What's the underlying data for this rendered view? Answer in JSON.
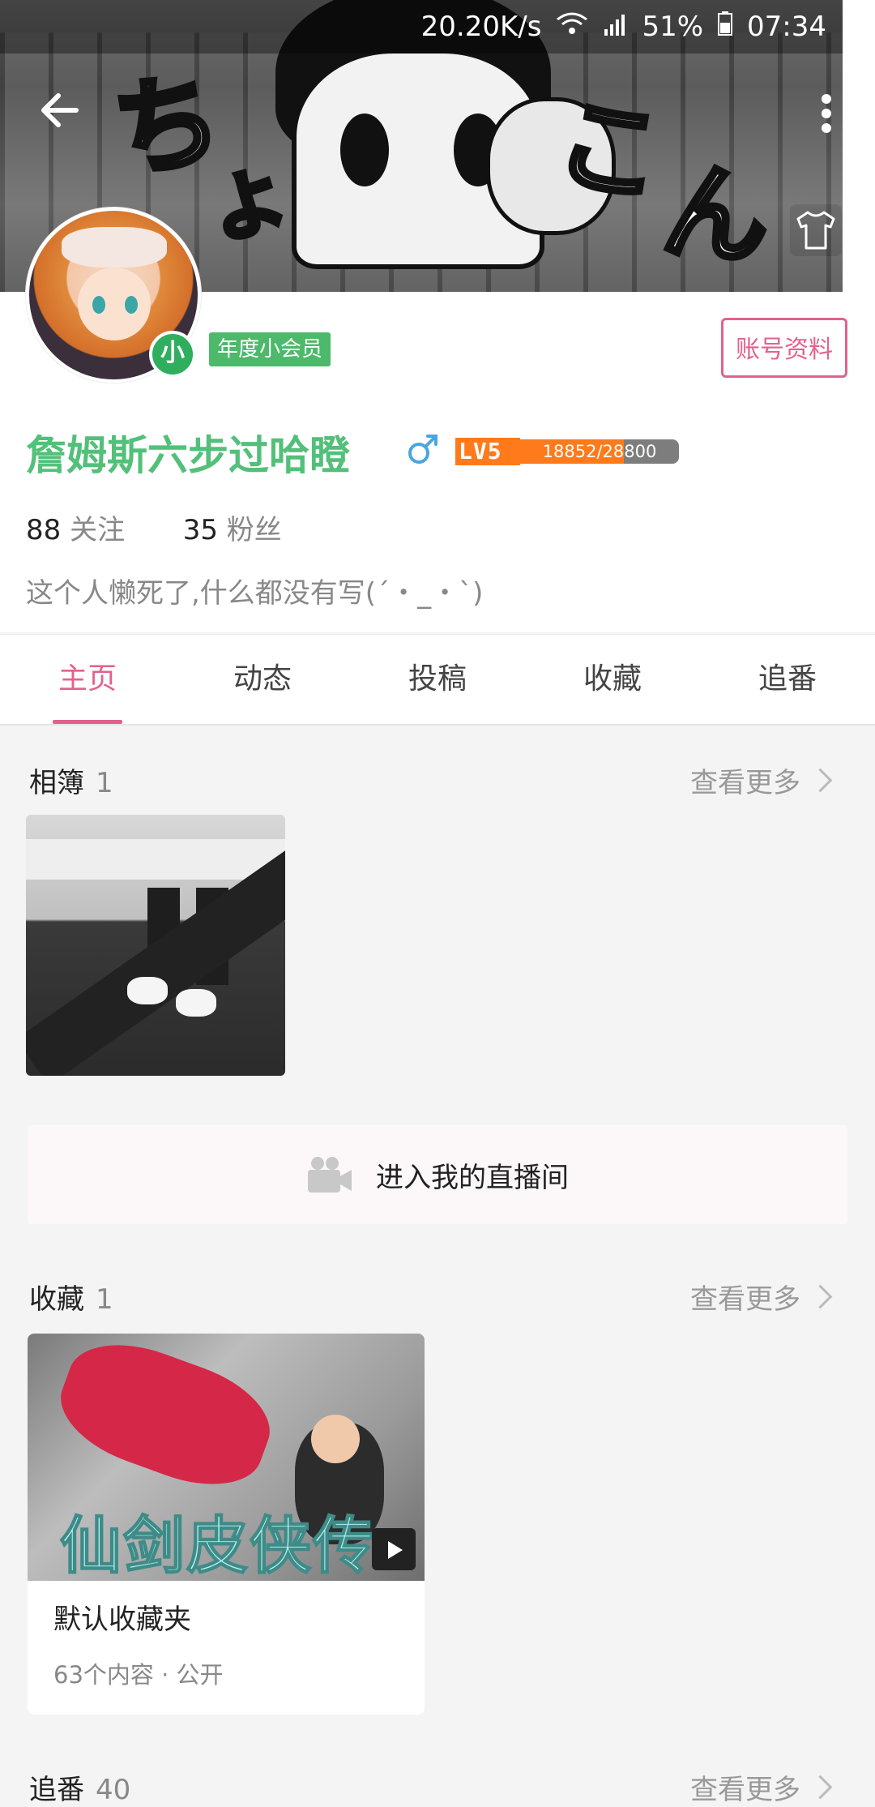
{
  "status_bar": {
    "net_speed": "20.20K/s",
    "battery": "51%",
    "time": "07:34"
  },
  "banner": {
    "text_a": "ち",
    "text_b": "よ",
    "text_c": "こ",
    "text_d": "ん"
  },
  "profile": {
    "avatar_badge": "小",
    "vip_label": "年度小会员",
    "account_button": "账号资料",
    "username": "詹姆斯六步过哈瞪",
    "level_label": "LV5",
    "level_progress_text": "18852/28800",
    "level_progress_fraction": 0.6546,
    "following_count": "88",
    "following_label": "关注",
    "fans_count": "35",
    "fans_label": "粉丝",
    "bio": "这个人懒死了,什么都没有写(´・_・`)"
  },
  "tabs": [
    {
      "label": "主页",
      "active": true
    },
    {
      "label": "动态",
      "active": false
    },
    {
      "label": "投稿",
      "active": false
    },
    {
      "label": "收藏",
      "active": false
    },
    {
      "label": "追番",
      "active": false
    }
  ],
  "album_section": {
    "title": "相簿",
    "count": "1",
    "more": "查看更多"
  },
  "live": {
    "label": "进入我的直播间"
  },
  "favorites_section": {
    "title": "收藏",
    "count": "1",
    "more": "查看更多",
    "card": {
      "cover_caption": "仙剑皮侠传",
      "title": "默认收藏夹",
      "subtitle": "63个内容 · 公开"
    }
  },
  "bangumi_section": {
    "title": "追番",
    "count": "40",
    "more": "查看更多"
  },
  "colors": {
    "accent_pink": "#e2628d",
    "name_green": "#53c07a",
    "level_orange": "#ff7a1a"
  }
}
